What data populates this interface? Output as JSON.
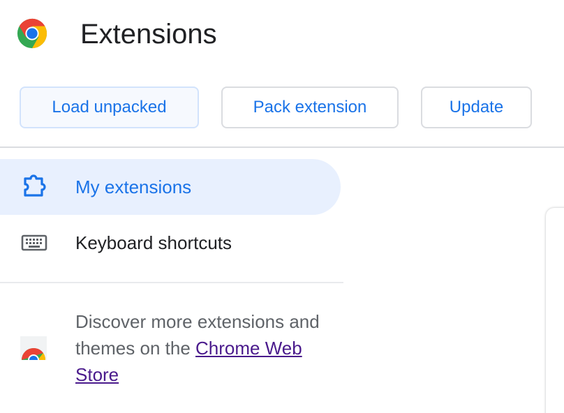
{
  "header": {
    "title": "Extensions",
    "logo_icon": "chrome-logo-icon"
  },
  "toolbar": {
    "load_unpacked": "Load unpacked",
    "pack_extension": "Pack extension",
    "update": "Update"
  },
  "sidebar": {
    "items": [
      {
        "label": "My extensions",
        "icon": "puzzle-piece-icon",
        "active": true
      },
      {
        "label": "Keyboard shortcuts",
        "icon": "keyboard-icon",
        "active": false
      }
    ],
    "discover": {
      "text_before": "Discover more extensions and themes on the ",
      "link_text": "Chrome Web Store",
      "icon": "chrome-web-store-icon"
    }
  },
  "colors": {
    "accent": "#1a73e8",
    "active_bg": "#e8f0fe",
    "link_visited": "#4a1a8c",
    "text_primary": "#202124",
    "text_secondary": "#5f6368"
  }
}
